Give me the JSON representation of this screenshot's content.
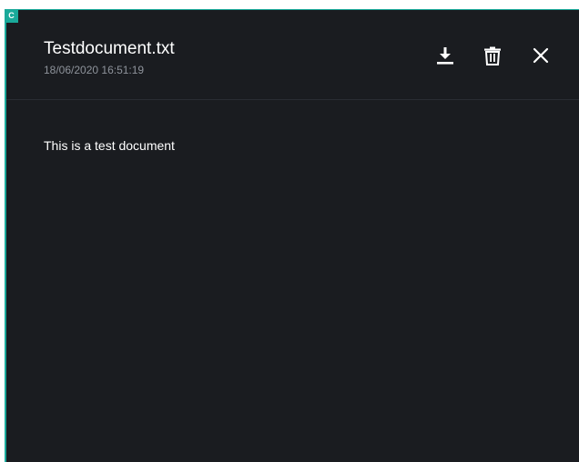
{
  "corner_badge": {
    "label": "C"
  },
  "document": {
    "title": "Testdocument.txt",
    "timestamp": "18/06/2020 16:51:19",
    "body": "This is a test document"
  },
  "actions": [
    {
      "name": "download",
      "icon": "download-icon"
    },
    {
      "name": "delete",
      "icon": "trash-icon"
    },
    {
      "name": "close",
      "icon": "close-icon"
    }
  ],
  "colors": {
    "background": "#1a1c20",
    "accent": "#1aa99a",
    "text": "#ffffff",
    "muted_text": "#8e939b"
  }
}
